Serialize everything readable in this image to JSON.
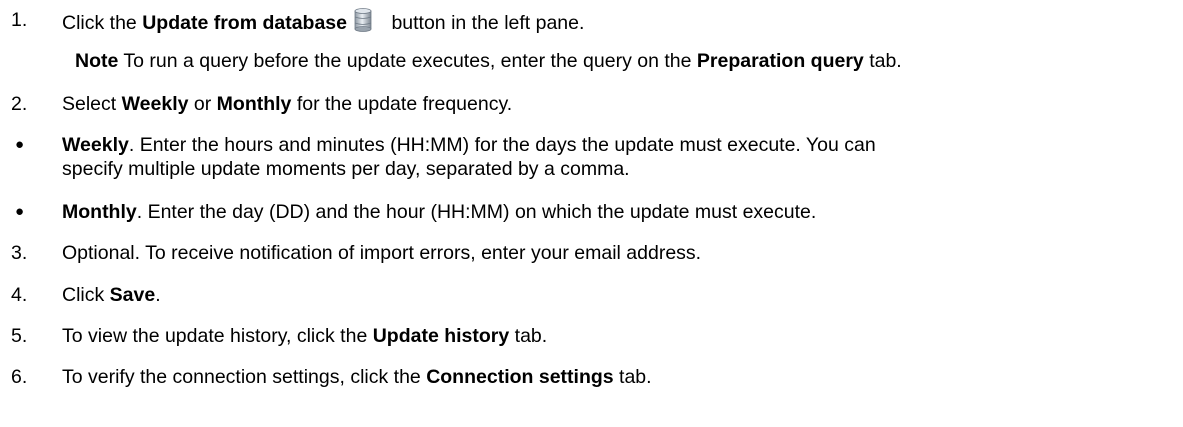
{
  "steps": {
    "s1": {
      "num": "1.",
      "pre": "Click the ",
      "bold": "Update from database",
      "post": "button in the left pane."
    },
    "note": {
      "bold": "Note",
      "pre": " To run a query before the update executes, enter the query on the ",
      "bold2": "Preparation query",
      "post": " tab."
    },
    "s2": {
      "num": "2.",
      "pre": "Select ",
      "bold": "Weekly",
      "mid": " or ",
      "bold2": "Monthly",
      "post": " for the update frequency."
    },
    "b1": {
      "bold": "Weekly",
      "text": ". Enter the hours and minutes (HH:MM) for the days the update must execute. You can",
      "text2": "specify multiple update moments per day, separated by a comma."
    },
    "b2": {
      "bold": "Monthly",
      "text": ". Enter the day (DD) and the hour (HH:MM) on which the update must execute."
    },
    "s3": {
      "num": "3.",
      "text": "Optional. To receive notification of import errors, enter your email address."
    },
    "s4": {
      "num": "4.",
      "pre": "Click ",
      "bold": "Save",
      "post": "."
    },
    "s5": {
      "num": "5.",
      "pre": "To view the update history, click the ",
      "bold": "Update history",
      "post": " tab."
    },
    "s6": {
      "num": "6.",
      "pre": "To verify the connection settings, click the ",
      "bold": "Connection settings",
      "post": " tab."
    }
  },
  "icons": {
    "update_from_database": "database-icon"
  }
}
